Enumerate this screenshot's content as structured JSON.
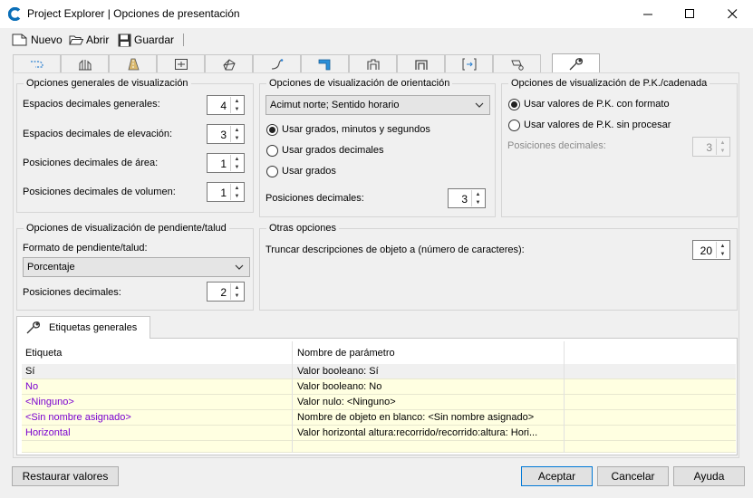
{
  "window": {
    "title": "Project Explorer | Opciones de presentación",
    "accent": "#0078d7"
  },
  "toolbar": {
    "new_label": "Nuevo",
    "open_label": "Abrir",
    "save_label": "Guardar"
  },
  "tabs": [
    {
      "icon": "alignment-dashed-icon"
    },
    {
      "icon": "profile-icon"
    },
    {
      "icon": "corridor-road-icon"
    },
    {
      "icon": "section-frame-icon"
    },
    {
      "icon": "surface-icon"
    },
    {
      "icon": "feature-line-icon"
    },
    {
      "icon": "pipe-network-icon"
    },
    {
      "icon": "assembly-icon"
    },
    {
      "icon": "subassembly-icon"
    },
    {
      "icon": "sample-line-icon"
    },
    {
      "icon": "point-group-icon"
    },
    {
      "icon": "wrench-settings-icon",
      "active": true
    }
  ],
  "general": {
    "legend": "Opciones generales de visualización",
    "rows": [
      {
        "label": "Espacios decimales generales:",
        "value": "4"
      },
      {
        "label": "Espacios decimales de elevación:",
        "value": "3"
      },
      {
        "label": "Posiciones decimales de área:",
        "value": "1"
      },
      {
        "label": "Posiciones decimales de volumen:",
        "value": "1"
      }
    ]
  },
  "orientation": {
    "legend": "Opciones de visualización de orientación",
    "combo_value": "Acimut norte; Sentido horario",
    "radios": [
      {
        "label": "Usar grados, minutos y segundos",
        "checked": true
      },
      {
        "label": "Usar grados decimales",
        "checked": false
      },
      {
        "label": "Usar grados",
        "checked": false
      }
    ],
    "decimals_label": "Posiciones decimales:",
    "decimals_value": "3"
  },
  "station": {
    "legend": "Opciones de visualización de P.K./cadenada",
    "radios": [
      {
        "label": "Usar valores de P.K. con formato",
        "checked": true
      },
      {
        "label": "Usar valores de P.K. sin procesar",
        "checked": false
      }
    ],
    "decimals_label": "Posiciones decimales:",
    "decimals_value": "3"
  },
  "slope": {
    "legend": "Opciones de visualización de pendiente/talud",
    "format_label": "Formato de pendiente/talud:",
    "combo_value": "Porcentaje",
    "decimals_label": "Posiciones decimales:",
    "decimals_value": "2"
  },
  "other": {
    "legend": "Otras opciones",
    "truncate_label": "Truncar descripciones de objeto a (número de caracteres):",
    "truncate_value": "20"
  },
  "labels_tab": {
    "title": "Etiquetas generales",
    "columns": [
      "Etiqueta",
      "Nombre de parámetro"
    ],
    "rows": [
      {
        "label": "Sí",
        "param": "Valor booleano: Sí"
      },
      {
        "label": "No",
        "param": "Valor booleano: No"
      },
      {
        "label": "<Ninguno>",
        "param": "Valor nulo: <Ninguno>"
      },
      {
        "label": "<Sin nombre asignado>",
        "param": "Nombre de objeto en blanco: <Sin nombre asignado>"
      },
      {
        "label": "Horizontal",
        "param": "Valor horizontal altura:recorrido/recorrido:altura: Hori..."
      }
    ]
  },
  "buttons": {
    "restore": "Restaurar valores",
    "accept": "Aceptar",
    "cancel": "Cancelar",
    "help": "Ayuda"
  }
}
